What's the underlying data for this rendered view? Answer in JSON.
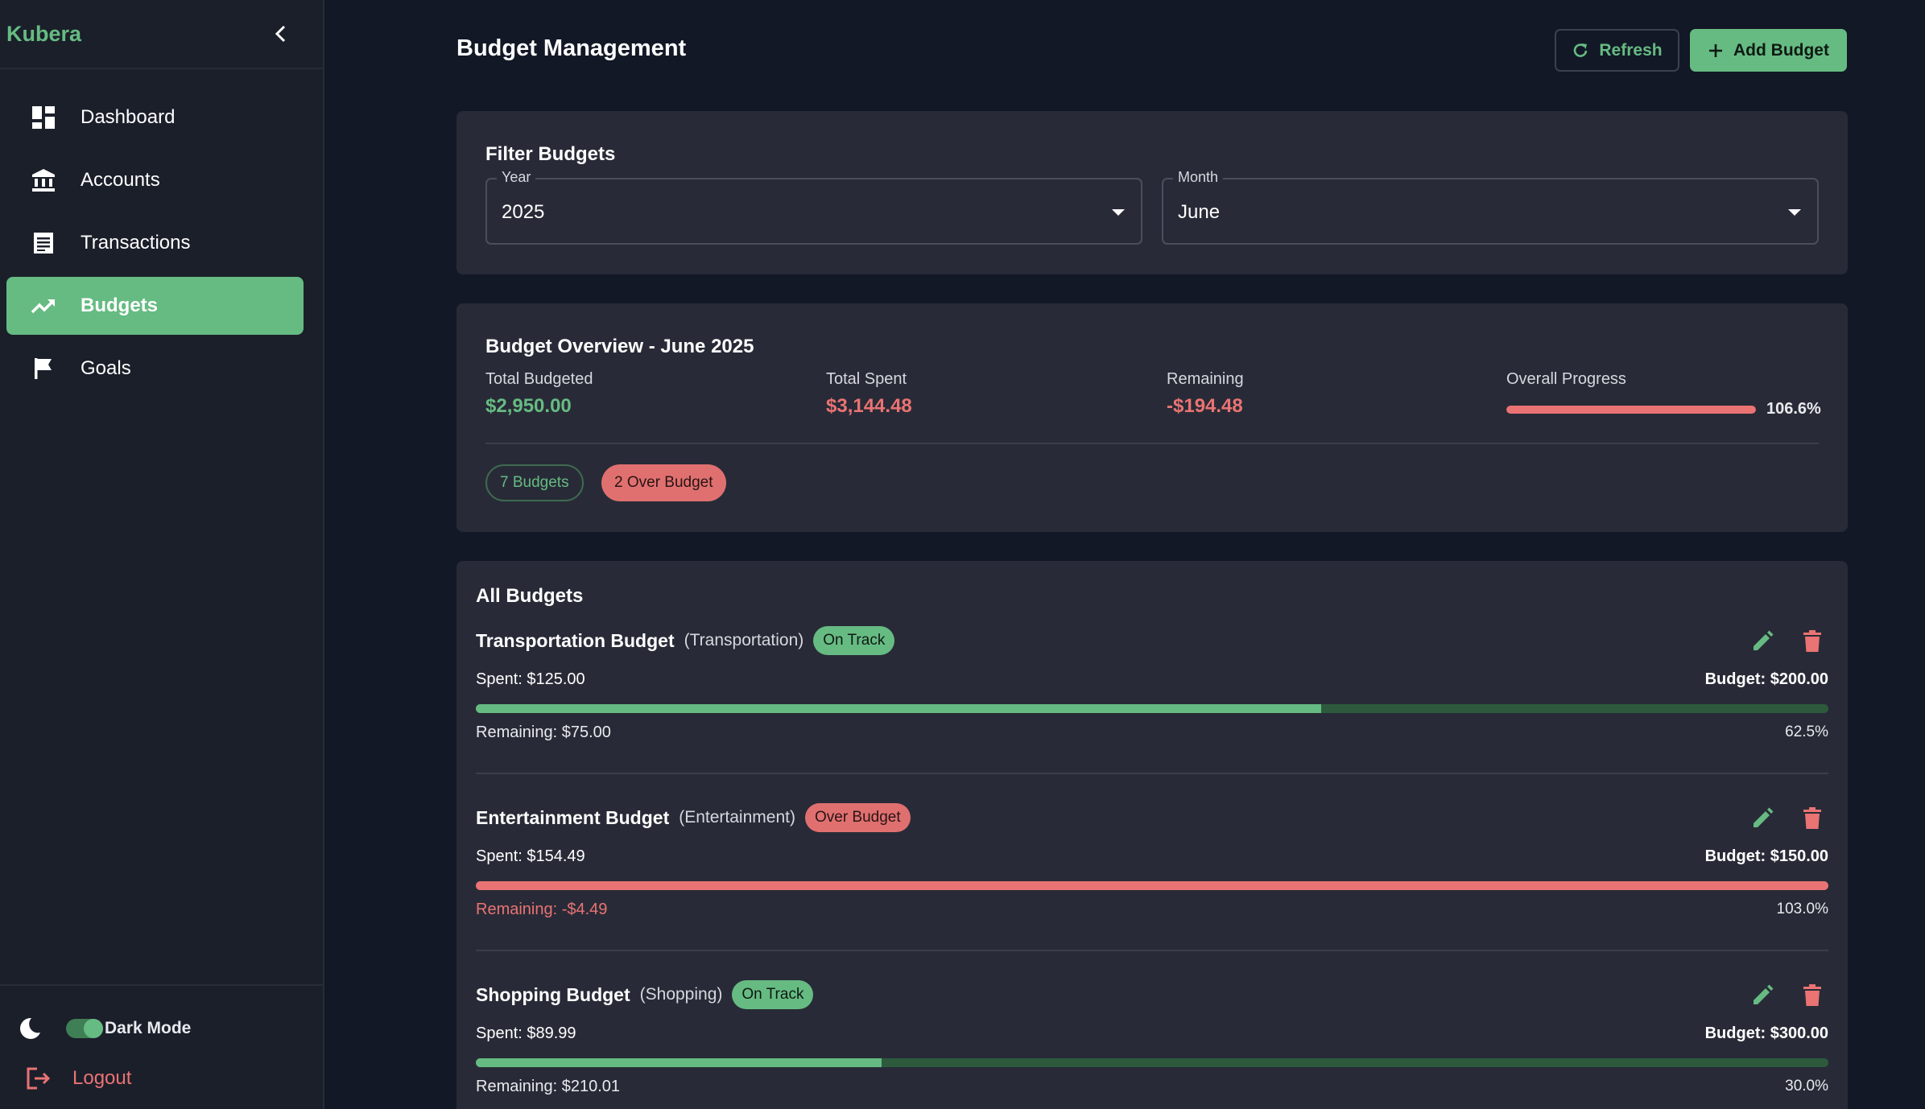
{
  "sidebar": {
    "brand": "Kubera",
    "items": [
      {
        "label": "Dashboard",
        "icon": "dashboard-icon"
      },
      {
        "label": "Accounts",
        "icon": "bank-icon"
      },
      {
        "label": "Transactions",
        "icon": "receipt-icon"
      },
      {
        "label": "Budgets",
        "icon": "trending-up-icon",
        "active": true
      },
      {
        "label": "Goals",
        "icon": "flag-icon"
      }
    ],
    "dark_mode_label": "Dark Mode",
    "dark_mode_on": true,
    "logout_label": "Logout"
  },
  "header": {
    "title": "Budget Management",
    "refresh_label": "Refresh",
    "add_label": "Add Budget"
  },
  "filter": {
    "title": "Filter Budgets",
    "year_label": "Year",
    "year_value": "2025",
    "month_label": "Month",
    "month_value": "June"
  },
  "overview": {
    "title": "Budget Overview - June 2025",
    "total_budgeted_label": "Total Budgeted",
    "total_budgeted": "$2,950.00",
    "total_spent_label": "Total Spent",
    "total_spent": "$3,144.48",
    "remaining_label": "Remaining",
    "remaining": "-$194.48",
    "progress_label": "Overall Progress",
    "progress_text": "106.6%",
    "progress_fraction": 1.0,
    "budgets_chip": "7 Budgets",
    "over_chip": "2 Over Budget"
  },
  "list": {
    "title": "All Budgets",
    "budgets": [
      {
        "name": "Transportation Budget",
        "category": "(Transportation)",
        "status": "On Track",
        "spent": "Spent: $125.00",
        "budget": "Budget: $200.00",
        "remaining": "Remaining: $75.00",
        "percent": "62.5%",
        "fraction": 0.625
      },
      {
        "name": "Entertainment Budget",
        "category": "(Entertainment)",
        "status": "Over Budget",
        "spent": "Spent: $154.49",
        "budget": "Budget: $150.00",
        "remaining": "Remaining: -$4.49",
        "percent": "103.0%",
        "fraction": 1.0
      },
      {
        "name": "Shopping Budget",
        "category": "(Shopping)",
        "status": "On Track",
        "spent": "Spent: $89.99",
        "budget": "Budget: $300.00",
        "remaining": "Remaining: $210.01",
        "percent": "30.0%",
        "fraction": 0.3
      }
    ]
  },
  "colors": {
    "accent": "#66bb82",
    "danger": "#ea7373",
    "background": "#121826",
    "card": "#282b37"
  }
}
